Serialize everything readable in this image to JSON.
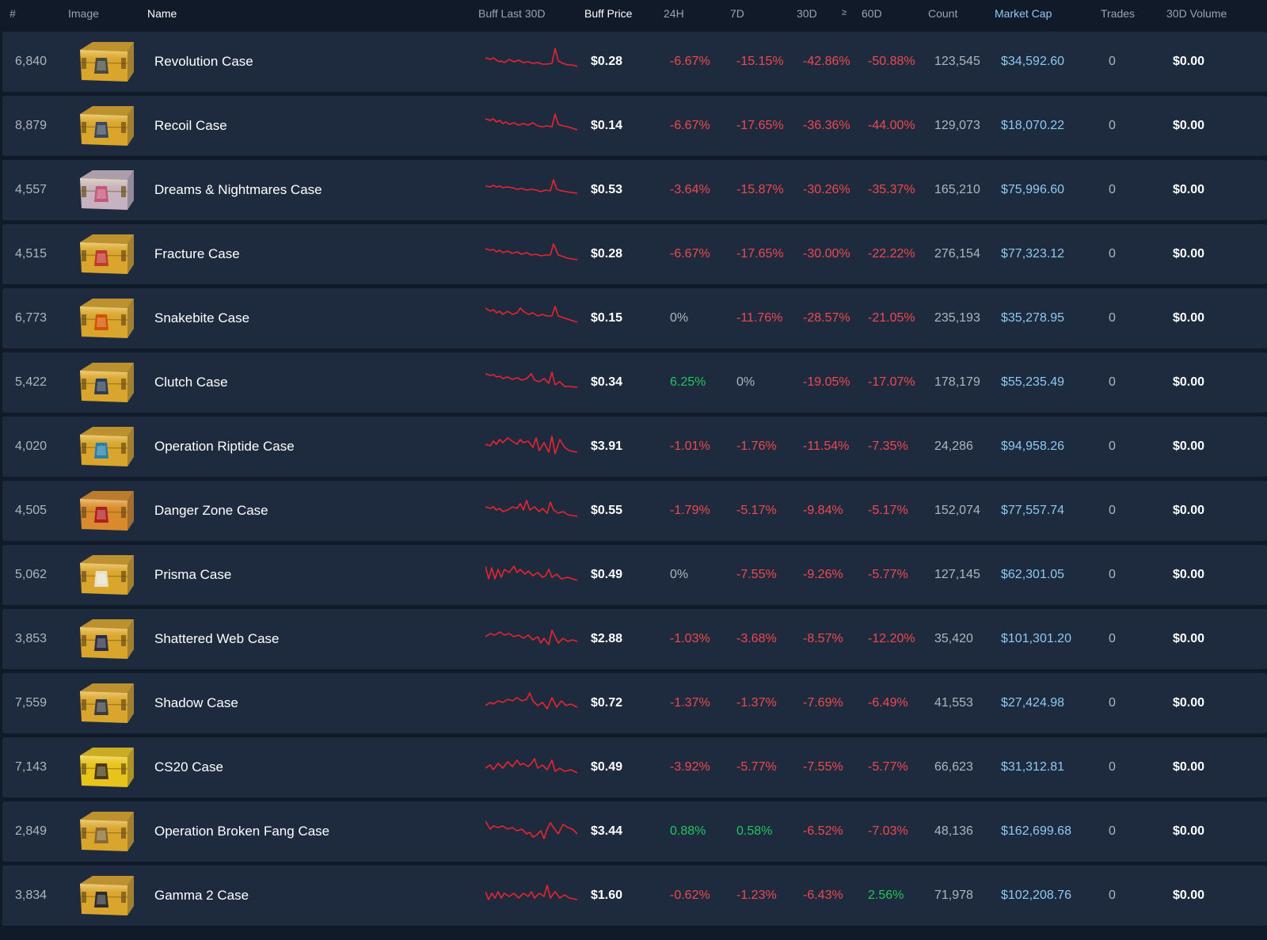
{
  "header": {
    "rank": "#",
    "image": "Image",
    "name": "Name",
    "buff_last_30d": "Buff Last 30D",
    "buff_price": "Buff Price",
    "h24": "24H",
    "d7": "7D",
    "d30": "30D",
    "d60": "60D",
    "count": "Count",
    "market_cap": "Market Cap",
    "trades": "Trades",
    "volume_30d": "30D Volume"
  },
  "colors": {
    "background": "#111a28",
    "row": "#1e2b3e",
    "negative": "#f0484e",
    "positive": "#22c55e",
    "market_cap": "#8ec9f1",
    "sparkline": "#e8242e"
  },
  "rows": [
    {
      "rank": "6,840",
      "name": "Revolution Case",
      "price": "$0.28",
      "h24": "-6.67%",
      "d7": "-15.15%",
      "d30": "-42.86%",
      "d60": "-50.88%",
      "count": "123,545",
      "mcap": "$34,592.60",
      "trades": "0",
      "volume": "$0.00",
      "icon": "revolution-case-icon",
      "case_color": "#d9a52c",
      "emblem_color": "#4a4a3c"
    },
    {
      "rank": "8,879",
      "name": "Recoil Case",
      "price": "$0.14",
      "h24": "-6.67%",
      "d7": "-17.65%",
      "d30": "-36.36%",
      "d60": "-44.00%",
      "count": "129,073",
      "mcap": "$18,070.22",
      "trades": "0",
      "volume": "$0.00",
      "icon": "recoil-case-icon",
      "case_color": "#d9a52c",
      "emblem_color": "#3b4a5a"
    },
    {
      "rank": "4,557",
      "name": "Dreams & Nightmares Case",
      "price": "$0.53",
      "h24": "-3.64%",
      "d7": "-15.87%",
      "d30": "-30.26%",
      "d60": "-35.37%",
      "count": "165,210",
      "mcap": "$75,996.60",
      "trades": "0",
      "volume": "$0.00",
      "icon": "dreams-nightmares-case-icon",
      "case_color": "#c7b3c0",
      "emblem_color": "#c4577a"
    },
    {
      "rank": "4,515",
      "name": "Fracture Case",
      "price": "$0.28",
      "h24": "-6.67%",
      "d7": "-17.65%",
      "d30": "-30.00%",
      "d60": "-22.22%",
      "count": "276,154",
      "mcap": "$77,323.12",
      "trades": "0",
      "volume": "$0.00",
      "icon": "fracture-case-icon",
      "case_color": "#d9a52c",
      "emblem_color": "#c0392b"
    },
    {
      "rank": "6,773",
      "name": "Snakebite Case",
      "price": "$0.15",
      "h24": "0%",
      "d7": "-11.76%",
      "d30": "-28.57%",
      "d60": "-21.05%",
      "count": "235,193",
      "mcap": "$35,278.95",
      "trades": "0",
      "volume": "$0.00",
      "icon": "snakebite-case-icon",
      "case_color": "#d9a52c",
      "emblem_color": "#d35400"
    },
    {
      "rank": "5,422",
      "name": "Clutch Case",
      "price": "$0.34",
      "h24": "6.25%",
      "d7": "0%",
      "d30": "-19.05%",
      "d60": "-17.07%",
      "count": "178,179",
      "mcap": "$55,235.49",
      "trades": "0",
      "volume": "$0.00",
      "icon": "clutch-case-icon",
      "case_color": "#d9a52c",
      "emblem_color": "#2c3e50"
    },
    {
      "rank": "4,020",
      "name": "Operation Riptide Case",
      "price": "$3.91",
      "h24": "-1.01%",
      "d7": "-1.76%",
      "d30": "-11.54%",
      "d60": "-7.35%",
      "count": "24,286",
      "mcap": "$94,958.26",
      "trades": "0",
      "volume": "$0.00",
      "icon": "operation-riptide-case-icon",
      "case_color": "#d9a52c",
      "emblem_color": "#2a7fa8"
    },
    {
      "rank": "4,505",
      "name": "Danger Zone Case",
      "price": "$0.55",
      "h24": "-1.79%",
      "d7": "-5.17%",
      "d30": "-9.84%",
      "d60": "-5.17%",
      "count": "152,074",
      "mcap": "$77,557.74",
      "trades": "0",
      "volume": "$0.00",
      "icon": "danger-zone-case-icon",
      "case_color": "#d98a2c",
      "emblem_color": "#b01e1e"
    },
    {
      "rank": "5,062",
      "name": "Prisma Case",
      "price": "$0.49",
      "h24": "0%",
      "d7": "-7.55%",
      "d30": "-9.26%",
      "d60": "-5.77%",
      "count": "127,145",
      "mcap": "$62,301.05",
      "trades": "0",
      "volume": "$0.00",
      "icon": "prisma-case-icon",
      "case_color": "#d9a52c",
      "emblem_color": "#e8e0c8"
    },
    {
      "rank": "3,853",
      "name": "Shattered Web Case",
      "price": "$2.88",
      "h24": "-1.03%",
      "d7": "-3.68%",
      "d30": "-8.57%",
      "d60": "-12.20%",
      "count": "35,420",
      "mcap": "$101,301.20",
      "trades": "0",
      "volume": "$0.00",
      "icon": "shattered-web-case-icon",
      "case_color": "#d9a52c",
      "emblem_color": "#2c2c44"
    },
    {
      "rank": "7,559",
      "name": "Shadow Case",
      "price": "$0.72",
      "h24": "-1.37%",
      "d7": "-1.37%",
      "d30": "-7.69%",
      "d60": "-6.49%",
      "count": "41,553",
      "mcap": "$27,424.98",
      "trades": "0",
      "volume": "$0.00",
      "icon": "shadow-case-icon",
      "case_color": "#d9a52c",
      "emblem_color": "#3c3c3c"
    },
    {
      "rank": "7,143",
      "name": "CS20 Case",
      "price": "$0.49",
      "h24": "-3.92%",
      "d7": "-5.77%",
      "d30": "-7.55%",
      "d60": "-5.77%",
      "count": "66,623",
      "mcap": "$31,312.81",
      "trades": "0",
      "volume": "$0.00",
      "icon": "cs20-case-icon",
      "case_color": "#e8c31c",
      "emblem_color": "#4a3c10"
    },
    {
      "rank": "2,849",
      "name": "Operation Broken Fang Case",
      "price": "$3.44",
      "h24": "0.88%",
      "d7": "0.58%",
      "d30": "-6.52%",
      "d60": "-7.03%",
      "count": "48,136",
      "mcap": "$162,699.68",
      "trades": "0",
      "volume": "$0.00",
      "icon": "operation-broken-fang-case-icon",
      "case_color": "#d9a52c",
      "emblem_color": "#8a6a2c"
    },
    {
      "rank": "3,834",
      "name": "Gamma 2 Case",
      "price": "$1.60",
      "h24": "-0.62%",
      "d7": "-1.23%",
      "d30": "-6.43%",
      "d60": "2.56%",
      "count": "71,978",
      "mcap": "$102,208.76",
      "trades": "0",
      "volume": "$0.00",
      "icon": "gamma-2-case-icon",
      "case_color": "#d9a52c",
      "emblem_color": "#2c2c2c"
    }
  ]
}
